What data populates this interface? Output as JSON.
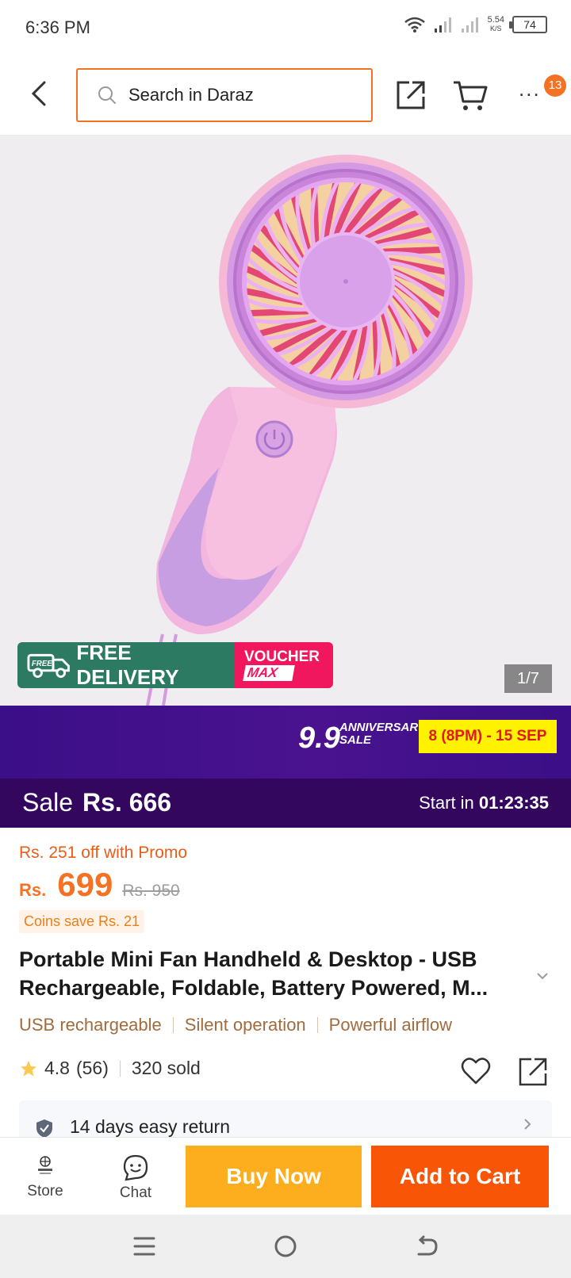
{
  "status": {
    "time": "6:36 PM",
    "speed_value": "5.54",
    "speed_unit": "K/S",
    "battery": "74"
  },
  "header": {
    "search_placeholder": "Search in Daraz",
    "more_badge": "13",
    "more_label": "..."
  },
  "gallery": {
    "free_delivery_tag": "FREE",
    "free_delivery_label": "FREE DELIVERY",
    "voucher_line1": "VOUCHER",
    "voucher_line2": "MAX",
    "counter": "1/7",
    "fan_colors": {
      "body": "#e9a8e6",
      "ring": "#c99be0",
      "blade": "#e9a6ef",
      "accent": "#e1306c"
    }
  },
  "campaign": {
    "big": "9.9",
    "anniv1": "ANNIVERSARY",
    "anniv2": "SALE",
    "date": "8 (8PM) - 15 SEP"
  },
  "sale": {
    "label": "Sale",
    "price": "Rs. 666",
    "countdown_label": "Start in",
    "countdown": "01:23:35"
  },
  "price": {
    "promo": "Rs. 251 off with Promo",
    "currency": "Rs.",
    "current": "699",
    "original": "Rs. 950",
    "coins": "Coins save Rs. 21"
  },
  "product": {
    "title": "Portable Mini Fan Handheld & Desktop - USB Rechargeable, Foldable, Battery Powered, M...",
    "features": [
      "USB rechargeable",
      "Silent operation",
      "Powerful airflow"
    ],
    "rating": "4.8",
    "reviews": "(56)",
    "sold": "320 sold"
  },
  "service": {
    "return": "14 days easy return"
  },
  "bottom": {
    "store": "Store",
    "chat": "Chat",
    "buy_now": "Buy Now",
    "add_to_cart": "Add to Cart"
  },
  "colors": {
    "accent": "#f57224",
    "buy_now": "#fcae1e",
    "add_to_cart": "#f85606",
    "campaign": "#3b0f87",
    "sale_bar": "#34075f"
  }
}
